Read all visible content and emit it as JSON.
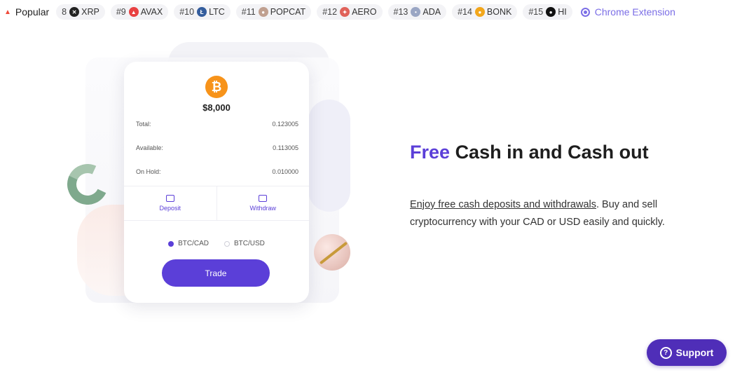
{
  "ticker": {
    "popular_label": "Popular",
    "items": [
      {
        "rank": "8",
        "symbol": "XRP",
        "icon": "xrp-icon",
        "color": "#222222"
      },
      {
        "rank": "#9",
        "symbol": "AVAX",
        "icon": "avax-icon",
        "color": "#e84142"
      },
      {
        "rank": "#10",
        "symbol": "LTC",
        "icon": "ltc-icon",
        "color": "#345d9d"
      },
      {
        "rank": "#11",
        "symbol": "POPCAT",
        "icon": "popcat-icon",
        "color": "#c0a090"
      },
      {
        "rank": "#12",
        "symbol": "AERO",
        "icon": "aero-icon",
        "color": "#e0625a"
      },
      {
        "rank": "#13",
        "symbol": "ADA",
        "icon": "ada-icon",
        "color": "#9aa6c4"
      },
      {
        "rank": "#14",
        "symbol": "BONK",
        "icon": "bonk-icon",
        "color": "#f2a61b"
      },
      {
        "rank": "#15",
        "symbol": "HI",
        "icon": "hi-icon",
        "color": "#111111"
      }
    ],
    "extension_label": "Chrome Extension"
  },
  "card": {
    "balance": "$8,000",
    "rows": [
      {
        "label": "Total:",
        "value": "0.123005"
      },
      {
        "label": "Available:",
        "value": "0.113005"
      },
      {
        "label": "On Hold:",
        "value": "0.010000"
      }
    ],
    "deposit_label": "Deposit",
    "withdraw_label": "Withdraw",
    "pair_options": [
      "BTC/CAD",
      "BTC/USD"
    ],
    "selected_pair": "BTC/CAD",
    "trade_label": "Trade"
  },
  "headline": {
    "highlight": "Free",
    "rest": "Cash in and Cash out"
  },
  "description": {
    "link_text": "Enjoy free cash deposits and withdrawals",
    "text": ". Buy and sell cryptocurrency with your CAD or USD easily and quickly."
  },
  "support_label": "Support",
  "colors": {
    "accent": "#5b3fd8",
    "support": "#4f2eb8",
    "bitcoin": "#f7931a"
  }
}
